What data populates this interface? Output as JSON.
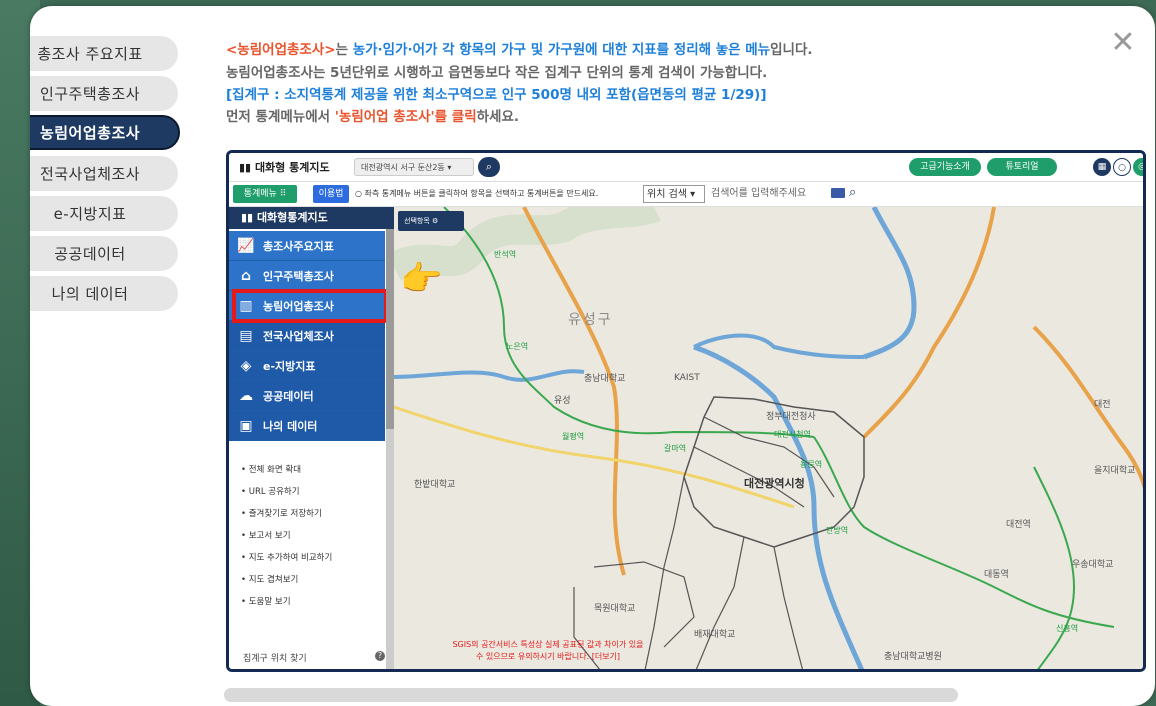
{
  "side_tabs": [
    {
      "label": "총조사 주요지표",
      "active": false
    },
    {
      "label": "인구주택총조사",
      "active": false
    },
    {
      "label": "농림어업총조사",
      "active": true
    },
    {
      "label": "전국사업체조사",
      "active": false
    },
    {
      "label": "e-지방지표",
      "active": false
    },
    {
      "label": "공공데이터",
      "active": false
    },
    {
      "label": "나의 데이터",
      "active": false
    }
  ],
  "close_label": "✕",
  "description": {
    "line1_red": "<농림어업총조사>",
    "line1_mid": "는 ",
    "line1_blue": "농가·임가·어가 각 항목의 가구 및 가구원에 대한 지표를 정리해 놓은 메뉴",
    "line1_end": "입니다.",
    "line2": "농림어업총조사는 5년단위로 시행하고 읍면동보다 작은 집계구 단위의 통계 검색이 가능합니다.",
    "line3_blue": "[집계구 : 소지역통계 제공을 위한 최소구역으로 인구 500명 내외 포함(읍면동의 평균 1/29)]",
    "line4_start": "먼저 통계메뉴에서 ",
    "line4_red": "'농림어업 총조사'를 클릭",
    "line4_end": "하세요."
  },
  "app": {
    "title": "대화형 통계지도",
    "region": "대전광역시 서구 둔산2동",
    "btn_feature_intro": "고급기능소개",
    "btn_tutorial": "튜토리얼",
    "menu_btn": "통계메뉴",
    "usage_btn": "이용법",
    "hint": "좌측 통계메뉴 버튼을 클릭하여 항목을 선택하고 통계버튼을 만드세요.",
    "location_search": "위치 검색",
    "search_placeholder": "검색어를 입력해주세요"
  },
  "sidebar": {
    "header": "대화형통계지도",
    "items": [
      {
        "label": "총조사주요지표",
        "icon": "chart-icon"
      },
      {
        "label": "인구주택총조사",
        "icon": "house-icon"
      },
      {
        "label": "농림어업총조사",
        "icon": "farm-icon"
      },
      {
        "label": "전국사업체조사",
        "icon": "building-icon"
      },
      {
        "label": "e-지방지표",
        "icon": "region-icon"
      },
      {
        "label": "공공데이터",
        "icon": "cloud-icon"
      },
      {
        "label": "나의 데이터",
        "icon": "document-icon"
      }
    ],
    "links": [
      "전체 화면 확대",
      "URL 공유하기",
      "즐겨찾기로 저장하기",
      "보고서 보기",
      "지도 추가하여 비교하기",
      "지도 겹쳐보기",
      "도움말 보기"
    ],
    "bottom": "집계구 위치 찾기"
  },
  "map": {
    "option_btn": "선택항목",
    "labels": {
      "yuseong_gu": "유성구",
      "station_banseok": "반석역",
      "station_noeun": "노은역",
      "station_wolpyeong": "월평역",
      "station_galma": "갈마역",
      "station_daejeon_cityhall": "대전시청역",
      "station_yongmun": "용문역",
      "station_tanbang": "탄방역",
      "station_sinheung": "신흥역",
      "station_daedong": "대동역",
      "ic_yuseong": "유성",
      "ic_daejeon": "대전",
      "hanbat_univ": "한밭대학교",
      "chungnam_univ": "충남대학교",
      "kaist": "KAIST",
      "daejeon_cityhall": "대전광역시청",
      "daejeon_govt": "정부대전청사",
      "mokwon_univ": "목원대학교",
      "paichai_univ": "배재대학교",
      "woosong_univ": "우송대학교",
      "chungnam_hospital": "충남대학교병원",
      "daejeon_station": "대전역",
      "eulji_univ": "을지대학교"
    },
    "notice": "SGIS의 공간서비스 특성상 실제 공표된 값과 차이가 있을 수 있으므로 유의하시기 바랍니다. [더보기]"
  }
}
